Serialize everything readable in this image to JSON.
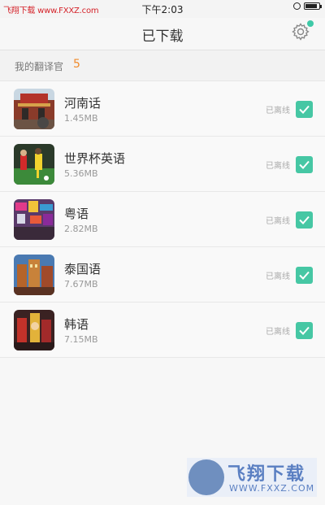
{
  "status_bar": {
    "watermark": "飞翔下载 www.FXXZ.com",
    "time": "下午2:03",
    "battery_level": 0.9
  },
  "nav": {
    "title": "已下载",
    "settings_icon": "gear-icon",
    "badge_color": "#3ec9a7"
  },
  "section": {
    "label": "我的翻译官",
    "count": "5"
  },
  "items": [
    {
      "name": "河南话",
      "size": "1.45MB",
      "status": "已离线",
      "checked": true
    },
    {
      "name": "世界杯英语",
      "size": "5.36MB",
      "status": "已离线",
      "checked": true
    },
    {
      "name": "粤语",
      "size": "2.82MB",
      "status": "已离线",
      "checked": true
    },
    {
      "name": "泰国语",
      "size": "7.67MB",
      "status": "已离线",
      "checked": true
    },
    {
      "name": "韩语",
      "size": "7.15MB",
      "status": "已离线",
      "checked": true
    }
  ],
  "watermark_logo": {
    "text": "飞翔下载",
    "url": "WWW.FXXZ.COM"
  },
  "colors": {
    "accent": "#46c7a4",
    "count": "#f08b2c"
  }
}
